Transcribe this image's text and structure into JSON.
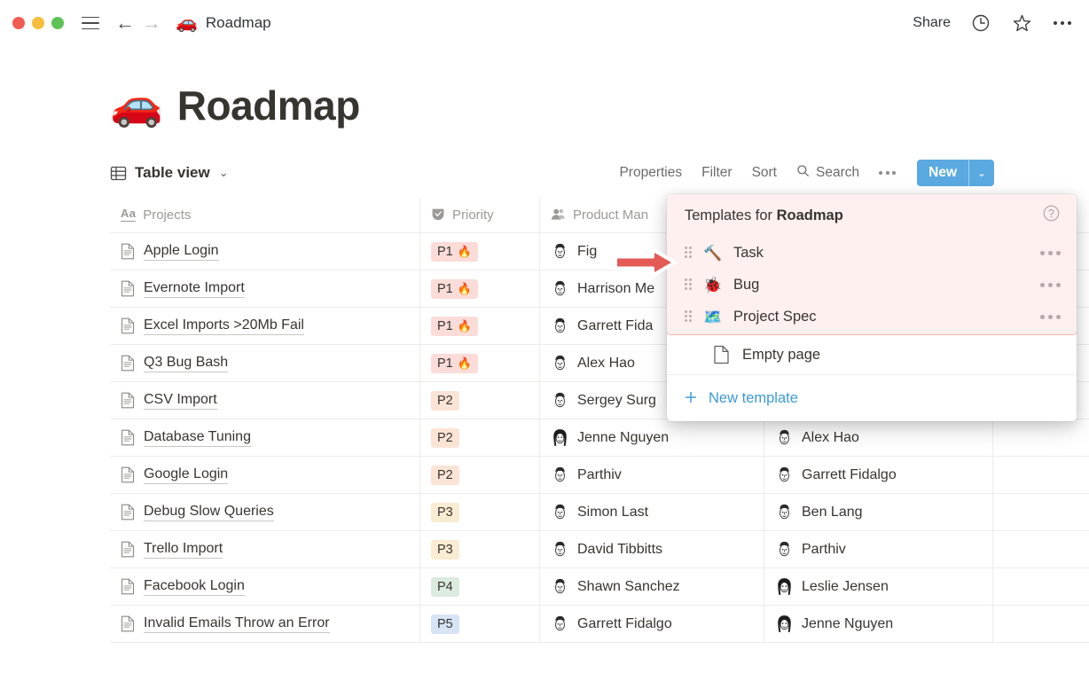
{
  "window": {
    "traffic_lights": [
      "close",
      "minimize",
      "maximize"
    ],
    "sidebar_toggle_icon": "hamburger-icon",
    "back_icon": "arrow-left-icon",
    "forward_icon": "arrow-right-icon",
    "doc_emoji": "🚗",
    "doc_title": "Roadmap",
    "share_label": "Share",
    "history_icon": "clock-icon",
    "favorite_icon": "star-icon",
    "more_icon": "ellipsis-icon"
  },
  "page": {
    "emoji": "🚗",
    "title": "Roadmap"
  },
  "viewbar": {
    "view_icon": "table-icon",
    "view_label": "Table view",
    "view_caret": "⌄",
    "properties_label": "Properties",
    "filter_label": "Filter",
    "sort_label": "Sort",
    "search_label": "Search",
    "search_icon": "search-icon",
    "more_icon": "ellipsis-icon",
    "new_label": "New",
    "new_caret": "⌄",
    "new_button_color": "#5aa9e0"
  },
  "table": {
    "columns": [
      {
        "key": "name",
        "label": "Projects",
        "icon": "text-type-icon"
      },
      {
        "key": "priority",
        "label": "Priority",
        "icon": "select-type-icon"
      },
      {
        "key": "pm",
        "label": "Product Man",
        "icon": "person-type-icon"
      },
      {
        "key": "eng",
        "label": "",
        "icon": ""
      },
      {
        "key": "extra",
        "label": "",
        "icon": ""
      }
    ],
    "rows": [
      {
        "name": "Apple Login",
        "priority": "P1",
        "priority_emoji": "🔥",
        "pm": "Fig",
        "eng": ""
      },
      {
        "name": "Evernote Import",
        "priority": "P1",
        "priority_emoji": "🔥",
        "pm": "Harrison Me",
        "eng": ""
      },
      {
        "name": "Excel Imports >20Mb Fail",
        "priority": "P1",
        "priority_emoji": "🔥",
        "pm": "Garrett Fida",
        "eng": ""
      },
      {
        "name": "Q3 Bug Bash",
        "priority": "P1",
        "priority_emoji": "🔥",
        "pm": "Alex Hao",
        "eng": ""
      },
      {
        "name": "CSV Import",
        "priority": "P2",
        "priority_emoji": "",
        "pm": "Sergey Surg",
        "eng": ""
      },
      {
        "name": "Database Tuning",
        "priority": "P2",
        "priority_emoji": "",
        "pm": "Jenne Nguyen",
        "eng": "Alex Hao"
      },
      {
        "name": "Google Login",
        "priority": "P2",
        "priority_emoji": "",
        "pm": "Parthiv",
        "eng": "Garrett Fidalgo"
      },
      {
        "name": "Debug Slow Queries",
        "priority": "P3",
        "priority_emoji": "",
        "pm": "Simon Last",
        "eng": "Ben Lang"
      },
      {
        "name": "Trello Import",
        "priority": "P3",
        "priority_emoji": "",
        "pm": "David Tibbitts",
        "eng": "Parthiv"
      },
      {
        "name": "Facebook Login",
        "priority": "P4",
        "priority_emoji": "",
        "pm": "Shawn Sanchez",
        "eng": "Leslie Jensen"
      },
      {
        "name": "Invalid Emails Throw an Error",
        "priority": "P5",
        "priority_emoji": "",
        "pm": "Garrett Fidalgo",
        "eng": "Jenne Nguyen"
      }
    ],
    "priority_colors": {
      "P1": "#fbdcd8",
      "P2": "#fbe4d6",
      "P3": "#faecd2",
      "P4": "#dcebe0",
      "P5": "#d6e4f5"
    }
  },
  "templates_popover": {
    "title_prefix": "Templates for ",
    "title_db": "Roadmap",
    "help_icon": "question-circle-icon",
    "items": [
      {
        "emoji": "🔨",
        "label": "Task",
        "grip_icon": "drag-handle-icon",
        "more_icon": "ellipsis-icon"
      },
      {
        "emoji": "🐞",
        "label": "Bug",
        "grip_icon": "drag-handle-icon",
        "more_icon": "ellipsis-icon"
      },
      {
        "emoji": "🗺️",
        "label": "Project Spec",
        "grip_icon": "drag-handle-icon",
        "more_icon": "ellipsis-icon"
      }
    ],
    "empty_page_label": "Empty page",
    "empty_page_icon": "page-icon",
    "new_template_label": "New template",
    "new_template_icon": "plus-icon",
    "highlight_color": "#fdf0ee",
    "highlight_border_color": "#f0b6ae",
    "link_color": "#3e9ad6"
  },
  "annotation": {
    "pointer_icon": "red-arrow-right-icon",
    "pointer_color": "#e35b54"
  }
}
